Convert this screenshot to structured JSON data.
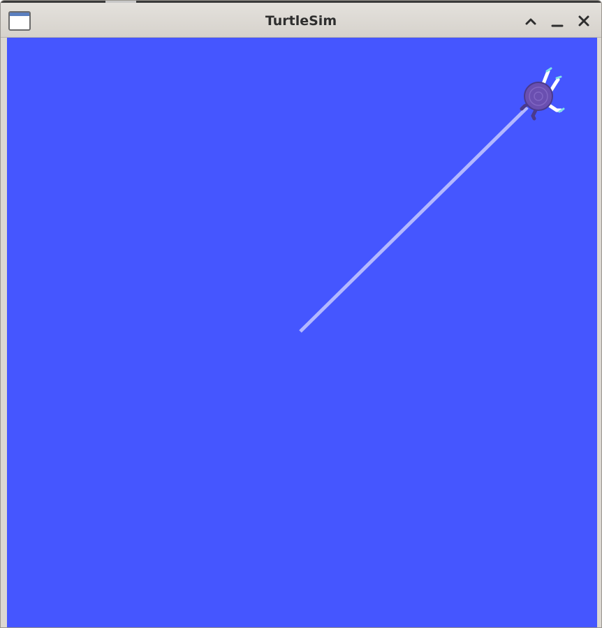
{
  "window": {
    "title": "TurtleSim",
    "app_icon": "window-icon",
    "buttons": [
      {
        "name": "maximize",
        "icon": "chevron-up-icon"
      },
      {
        "name": "minimize",
        "icon": "minimize-icon"
      },
      {
        "name": "close",
        "icon": "close-icon"
      }
    ]
  },
  "canvas": {
    "background_color": "#4556ff",
    "pen_color": "#b3b8ff",
    "turtle": {
      "shell_color": "#6a4fb0",
      "limb_color": "#4a3a8c",
      "accent_color": "#7fe0e6"
    }
  }
}
